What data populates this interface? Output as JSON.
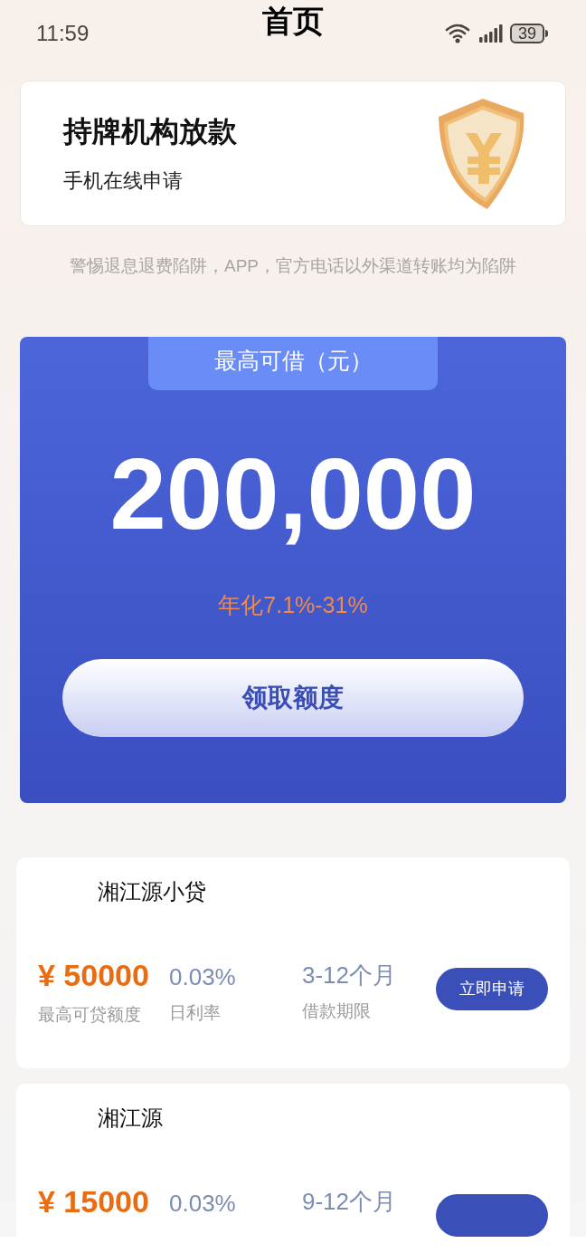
{
  "status_bar": {
    "time": "11:59",
    "battery": "39"
  },
  "header": {
    "title": "首页"
  },
  "banner": {
    "title": "持牌机构放款",
    "subtitle": "手机在线申请"
  },
  "warning": "警惕退息退费陷阱，APP，官方电话以外渠道转账均为陷阱",
  "limit_card": {
    "tab_label": "最高可借（元）",
    "amount": "200,000",
    "rate": "年化7.1%-31%",
    "button": "领取额度"
  },
  "products": [
    {
      "name": "湘江源小贷",
      "amount": "¥ 50000",
      "amount_label": "最高可贷额度",
      "rate": "0.03%",
      "rate_label": "日利率",
      "term": "3-12个月",
      "term_label": "借款期限",
      "button": "立即申请"
    },
    {
      "name": "湘江源",
      "amount": "¥ 15000",
      "rate": "0.03%",
      "term": "9-12个月"
    }
  ]
}
